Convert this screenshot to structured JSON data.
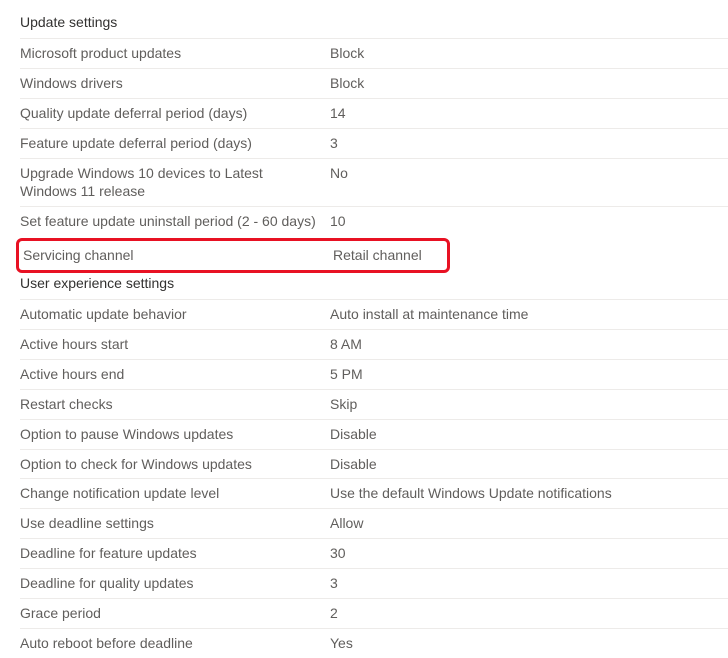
{
  "sections": [
    {
      "header": "Update settings",
      "rows": [
        {
          "label": "Microsoft product updates",
          "value": "Block"
        },
        {
          "label": "Windows drivers",
          "value": "Block"
        },
        {
          "label": "Quality update deferral period (days)",
          "value": "14"
        },
        {
          "label": "Feature update deferral period (days)",
          "value": "3"
        },
        {
          "label": "Upgrade Windows 10 devices to Latest Windows 11 release",
          "value": "No"
        },
        {
          "label": "Set feature update uninstall period (2 - 60 days)",
          "value": "10"
        },
        {
          "label": "Servicing channel",
          "value": "Retail channel",
          "highlight": true
        }
      ]
    },
    {
      "header": "User experience settings",
      "rows": [
        {
          "label": "Automatic update behavior",
          "value": "Auto install at maintenance time"
        },
        {
          "label": "Active hours start",
          "value": "8 AM"
        },
        {
          "label": "Active hours end",
          "value": "5 PM"
        },
        {
          "label": "Restart checks",
          "value": "Skip"
        },
        {
          "label": "Option to pause Windows updates",
          "value": "Disable"
        },
        {
          "label": "Option to check for Windows updates",
          "value": "Disable"
        },
        {
          "label": "Change notification update level",
          "value": "Use the default Windows Update notifications"
        },
        {
          "label": "Use deadline settings",
          "value": "Allow"
        },
        {
          "label": "Deadline for feature updates",
          "value": "30"
        },
        {
          "label": "Deadline for quality updates",
          "value": "3"
        },
        {
          "label": "Grace period",
          "value": "2"
        },
        {
          "label": "Auto reboot before deadline",
          "value": "Yes"
        }
      ]
    }
  ]
}
